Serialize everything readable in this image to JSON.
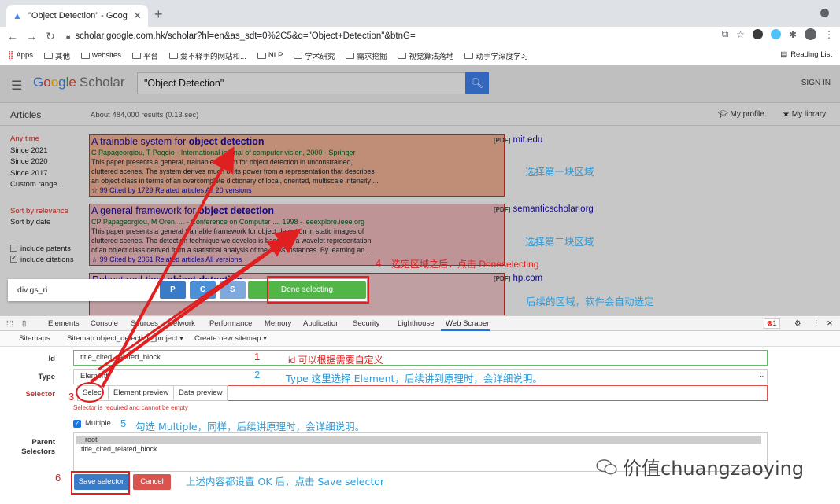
{
  "browser": {
    "tab_title": "\"Object Detection\" - Google S",
    "url": "scholar.google.com.hk/scholar?hl=en&as_sdt=0%2C5&q=\"Object+Detection\"&btnG=",
    "bookmarks": [
      "Apps",
      "其他",
      "websites",
      "平台",
      "爱不释手的网站和...",
      "NLP",
      "学术研究",
      "需求挖掘",
      "视觉算法落地",
      "动手学深度学习"
    ],
    "reading_list": "Reading List"
  },
  "scholar": {
    "logo_google": [
      "G",
      "o",
      "o",
      "g",
      "l",
      "e"
    ],
    "logo_scholar": "Scholar",
    "search_value": "\"Object Detection\"",
    "sign_in": "SIGN IN",
    "articles_label": "Articles",
    "results_count": "About 484,000 results (0.13 sec)",
    "my_profile": "My profile",
    "my_library": "My library",
    "sidebar": {
      "time": [
        "Any time",
        "Since 2021",
        "Since 2020",
        "Since 2017",
        "Custom range..."
      ],
      "sort": [
        "Sort by relevance",
        "Sort by date"
      ],
      "include_patents": "include patents",
      "include_citations": "include citations"
    },
    "results": [
      {
        "title_pre": "A trainable system for ",
        "title_bold": "object detection",
        "authors": "C Papageorgiou, T Poggio - International journal of computer vision, 2000 - Springer",
        "snippet": [
          "This paper presents a general, trainable system for object detection in unconstrained,",
          "cluttered scenes. The system derives much of its power from a representation that describes",
          "an object class in terms of an overcomplete dictionary of local, oriented, multiscale intensity ..."
        ],
        "links": "☆  99  Cited by 1729   Related articles   All 20 versions",
        "pdf_tag": "[PDF]",
        "pdf_source": "mit.edu"
      },
      {
        "title_pre": "A general framework for ",
        "title_bold": "object detection",
        "authors": "CP Papageorgiou, M Oren, ... - Conference on Computer ..., 1998 - ieeexplore.ieee.org",
        "snippet": [
          "This paper presents a general trainable framework for object detection in static images of",
          "cluttered scenes. The detection technique we develop is based on a wavelet representation",
          "of an object class derived from a statistical analysis of the class instances. By learning an ..."
        ],
        "links": "☆  99  Cited by 2061   Related articles   All versions",
        "pdf_tag": "[PDF]",
        "pdf_source": "semanticscholar.org"
      },
      {
        "title_pre": "Robust real-time ",
        "title_bold": "object detection",
        "pdf_tag": "[PDF]",
        "pdf_source": "hp.com"
      }
    ]
  },
  "scraper_toolbar": {
    "selector_text": "div.gs_ri",
    "btn_p": "P",
    "btn_c": "C",
    "btn_s": "S",
    "btn_done": "Done selecting"
  },
  "devtools": {
    "tabs": [
      "Elements",
      "Console",
      "Sources",
      "Network",
      "Performance",
      "Memory",
      "Application",
      "Security",
      "Lighthouse",
      "Web Scraper"
    ],
    "error_count": "1",
    "ws_nav": [
      "Sitemaps",
      "Sitemap object_detection_project ▾",
      "Create new sitemap ▾"
    ]
  },
  "form": {
    "id_label": "Id",
    "id_value": "title_cited_related_block",
    "type_label": "Type",
    "type_value": "Element",
    "selector_label": "Selector",
    "select_tab": "Select",
    "element_preview_tab": "Element preview",
    "data_preview_tab": "Data preview",
    "selector_error": "Selector is required and cannot be empty",
    "multiple_label": "Multiple",
    "parent_label": "Parent Selectors",
    "parent_root": "_root",
    "parent_item": "title_cited_related_block",
    "save_label": "Save selector",
    "cancel_label": "Cancel"
  },
  "annotations": {
    "n1": "1",
    "n2": "2",
    "n3": "3",
    "n4": "4",
    "n5": "5",
    "n6": "6",
    "a1": "id 可以根据需要自定义",
    "a2": "Type 这里选择 Element，后续讲到原理时，会详细说明。",
    "a4": "选定区域之后，点击 Doneselecting",
    "a5": "勾选 Multiple，同样，后续讲原理时，会详细说明。",
    "a6": "上述内容都设置 OK 后，点击 Save selector",
    "region1": "选择第一块区域",
    "region2": "选择第二块区域",
    "region3": "后续的区域，软件会自动选定",
    "watermark": "价值chuangzaoying"
  },
  "colors": {
    "annotation_red": "#e02020",
    "annotation_blue": "#2f9bd8",
    "done_green": "#52b548",
    "link_blue": "#1a0dab"
  }
}
